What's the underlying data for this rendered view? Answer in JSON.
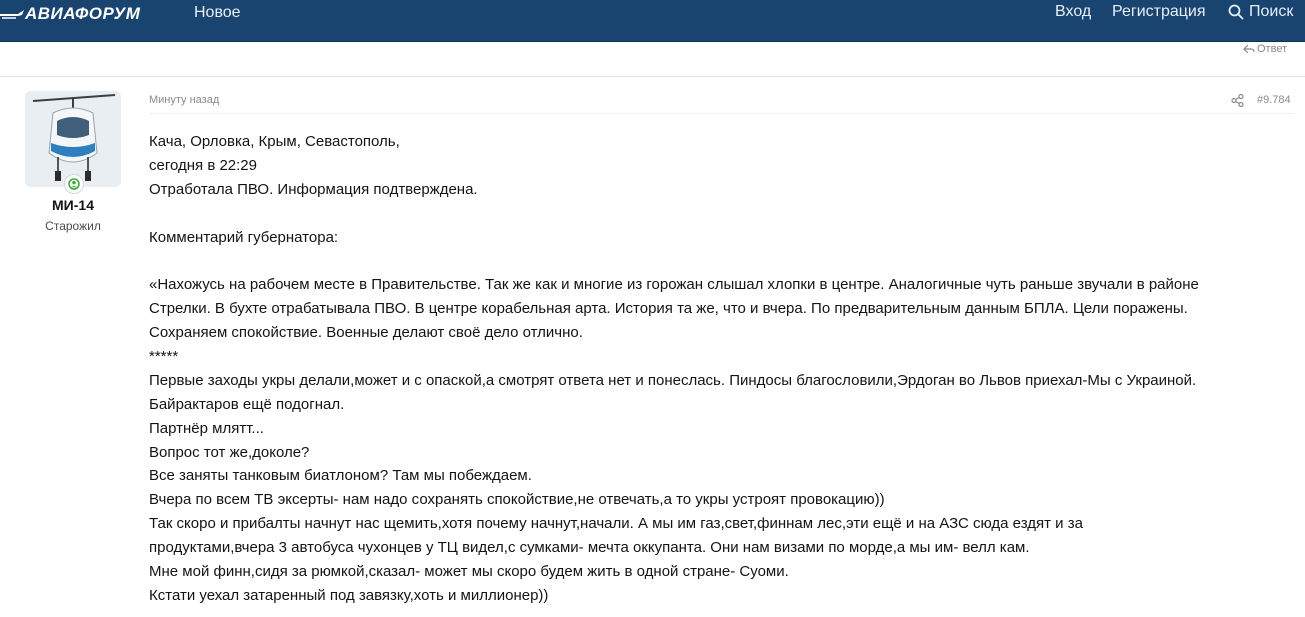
{
  "header": {
    "logo_text": "АВИАФОРУМ",
    "nav_new": "Новое",
    "login": "Вход",
    "register": "Регистрация",
    "search": "Поиск"
  },
  "thread": {
    "reply_label": "Ответ"
  },
  "post": {
    "author": {
      "name": "МИ-14",
      "title": "Старожил",
      "avatar_icon": "helicopter-avatar",
      "status_icon": "online-badge-icon"
    },
    "time": "Минуту назад",
    "number": "#9.784",
    "lines": [
      "Кача, Орловка, Крым, Севастополь,",
      "сегодня в 22:29",
      "Отработала ПВО. Информация подтверждена.",
      "",
      "Комментарий губернатора:",
      "",
      "«Нахожусь на рабочем месте в Правительстве. Так же как и многие из горожан слышал хлопки в центре. Аналогичные чуть раньше звучали в районе",
      "Стрелки. В бухте отрабатывала ПВО. В центре корабельная арта. История та же, что и вчера. По предварительным данным БПЛА. Цели поражены.",
      "Сохраняем спокойствие. Военные делают своё дело отлично.",
      "*****",
      "Первые заходы укры делали,может и с опаской,а смотрят ответа нет и понеслась. Пиндосы благословили,Эрдоган во Львов приехал-Мы с Украиной.",
      "Байрактаров ещё подогнал.",
      "Партнёр млятт...",
      "Вопрос тот же,доколе?",
      "Все заняты танковым биатлоном? Там мы побеждаем.",
      "Вчера по всем ТВ эксерты- нам надо сохранять спокойствие,не отвечать,а то укры устроят провокацию))",
      "Так скоро и прибалты начнут нас щемить,хотя почему начнут,начали. А мы им газ,свет,финнам лес,эти ещё и на АЗС сюда ездят и за",
      "продуктами,вчера 3 автобуса чухонцев у ТЦ видел,с сумками- мечта оккупанта. Они нам визами по морде,а мы им- велл кам.",
      "Мне мой финн,сидя за рюмкой,сказал- может мы скоро будем жить в одной стране- Суоми.",
      "Кстати уехал затаренный под завязку,хоть и миллионер))"
    ]
  },
  "colors": {
    "header_bg": "#1a4470",
    "meta_text": "#8a8a8a",
    "online_green": "#3aa935"
  }
}
